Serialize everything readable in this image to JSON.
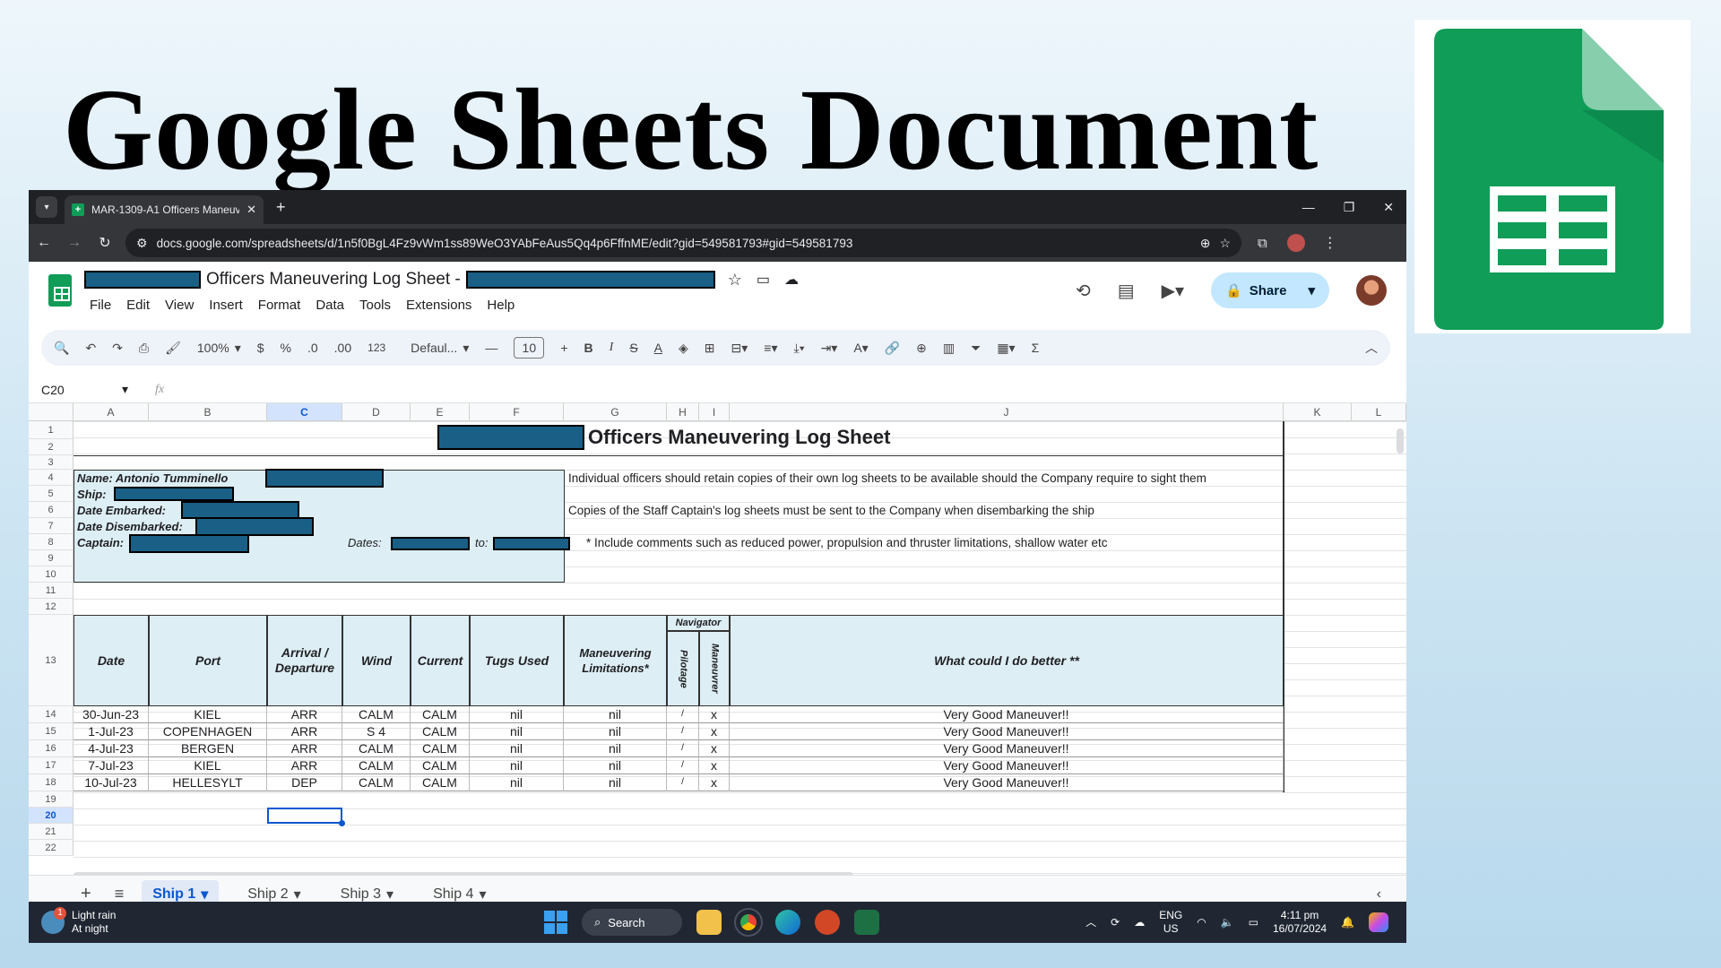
{
  "slide": {
    "title": "Google Sheets Document"
  },
  "browser": {
    "tab_title": "MAR-1309-A1 Officers Maneuv…",
    "url": "docs.google.com/spreadsheets/d/1n5f0BgL4Fz9vWm1ss89WeO3YAbFeAus5Qq4p6FffnME/edit?gid=549581793#gid=549581793"
  },
  "doc": {
    "title": "Officers Maneuvering Log Sheet -",
    "menus": [
      "File",
      "Edit",
      "View",
      "Insert",
      "Format",
      "Data",
      "Tools",
      "Extensions",
      "Help"
    ],
    "share_label": "Share"
  },
  "toolbar": {
    "zoom": "100%",
    "currency": "$",
    "percent": "%",
    "dec_less": ".0",
    "dec_more": ".00",
    "num_fmt": "123",
    "font": "Defaul...",
    "font_size": "10"
  },
  "formula_bar": {
    "cell_ref": "C20",
    "fx": "fx"
  },
  "columns": [
    "A",
    "B",
    "C",
    "D",
    "E",
    "F",
    "G",
    "H",
    "I",
    "J",
    "K",
    "L"
  ],
  "rows": [
    "1",
    "2",
    "3",
    "4",
    "5",
    "6",
    "7",
    "8",
    "9",
    "10",
    "11",
    "12",
    "13",
    "14",
    "15",
    "16",
    "17",
    "18",
    "19",
    "20",
    "21",
    "22"
  ],
  "sheet": {
    "title": "Officers Maneuvering Log Sheet",
    "info": {
      "name": "Name: Antonio Tumminello",
      "ship": "Ship:",
      "embarked": "Date Embarked:",
      "disembarked": "Date Disembarked:",
      "captain": "Captain:",
      "dates": "Dates:",
      "to": "to:"
    },
    "notes": [
      "Individual officers should retain copies of their own log sheets to be available should the Company require to sight them",
      "Copies of the Staff Captain's log sheets must be sent to the Company when disembarking the ship",
      "* Include comments such as reduced power, propulsion and thruster limitations, shallow water etc"
    ],
    "headers": {
      "date": "Date",
      "port": "Port",
      "arrival": "Arrival / Departure",
      "wind": "Wind",
      "current": "Current",
      "tugs": "Tugs Used",
      "limits": "Maneuvering Limitations*",
      "navigator": "Navigator",
      "pilotage": "Pilotage",
      "maneuver": "Maneuvrer",
      "better": "What could I do better **"
    },
    "log_rows": [
      {
        "date": "30-Jun-23",
        "port": "KIEL",
        "arr": "ARR",
        "wind": "CALM",
        "current": "CALM",
        "tugs": "nil",
        "limits": "nil",
        "pilot": "/",
        "man": "x",
        "better": "Very Good Maneuver!!"
      },
      {
        "date": "1-Jul-23",
        "port": "COPENHAGEN",
        "arr": "ARR",
        "wind": "S 4",
        "current": "CALM",
        "tugs": "nil",
        "limits": "nil",
        "pilot": "/",
        "man": "x",
        "better": "Very Good Maneuver!!"
      },
      {
        "date": "4-Jul-23",
        "port": "BERGEN",
        "arr": "ARR",
        "wind": "CALM",
        "current": "CALM",
        "tugs": "nil",
        "limits": "nil",
        "pilot": "/",
        "man": "x",
        "better": "Very Good Maneuver!!"
      },
      {
        "date": "7-Jul-23",
        "port": "KIEL",
        "arr": "ARR",
        "wind": "CALM",
        "current": "CALM",
        "tugs": "nil",
        "limits": "nil",
        "pilot": "/",
        "man": "x",
        "better": "Very Good Maneuver!!"
      },
      {
        "date": "10-Jul-23",
        "port": "HELLESYLT",
        "arr": "DEP",
        "wind": "CALM",
        "current": "CALM",
        "tugs": "nil",
        "limits": "nil",
        "pilot": "/",
        "man": "x",
        "better": "Very Good Maneuver!!"
      }
    ]
  },
  "sheet_tabs": [
    "Ship 1",
    "Ship 2",
    "Ship 3",
    "Ship 4"
  ],
  "taskbar": {
    "weather_title": "Light rain",
    "weather_sub": "At night",
    "weather_badge": "1",
    "search": "Search",
    "lang": "ENG",
    "region": "US",
    "time": "4:11 pm",
    "date": "16/07/2024"
  },
  "colors": {
    "accent": "#0b57d0",
    "redaction": "#1a5f85",
    "header_fill": "#ddeef4",
    "sheets_green": "#0f9d58"
  }
}
